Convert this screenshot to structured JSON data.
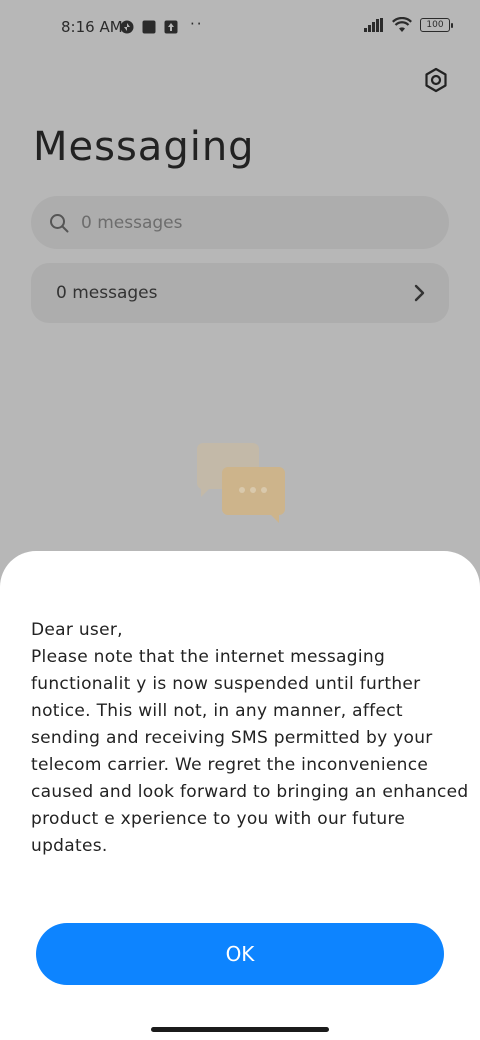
{
  "status_bar": {
    "time": "8:16 AM",
    "battery": "100"
  },
  "app": {
    "title": "Messaging",
    "search": {
      "placeholder": "0 messages"
    },
    "list_card": {
      "label": "0 messages"
    }
  },
  "dialog": {
    "message": "Dear user,\nPlease note that the internet messaging functionalit y is now suspended until further notice. This will not, in any manner, affect sending and receiving SMS permitted by your telecom carrier. We regret the inconvenience caused and look forward to bringing an enhanced product e xperience to you with our future updates.",
    "ok_label": "OK"
  },
  "colors": {
    "accent": "#0d84ff",
    "dim_background": "#b7b7b7",
    "sheet": "#ffffff"
  },
  "icons": [
    "data-icon",
    "square-icon",
    "upload-icon",
    "signal-icon",
    "wifi-icon",
    "battery-icon",
    "settings-icon",
    "search-icon",
    "chevron-right-icon",
    "chat-bubbles-illustration"
  ]
}
